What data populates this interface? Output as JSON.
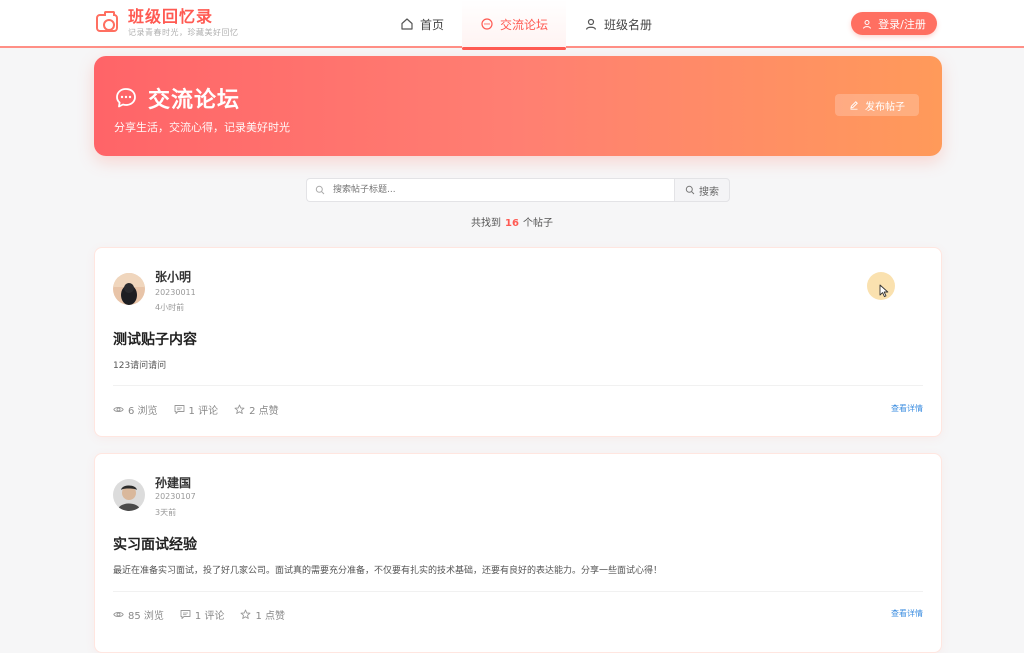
{
  "brand": {
    "title": "班级回忆录",
    "subtitle": "记录青春时光，珍藏美好回忆"
  },
  "nav": {
    "items": [
      {
        "label": "首页",
        "icon": "home-icon",
        "active": false
      },
      {
        "label": "交流论坛",
        "icon": "chat-icon",
        "active": true
      },
      {
        "label": "班级名册",
        "icon": "user-icon",
        "active": false
      }
    ],
    "login_label": "登录/注册"
  },
  "hero": {
    "title": "交流论坛",
    "subtitle": "分享生活，交流心得，记录美好时光",
    "post_button": "发布帖子"
  },
  "search": {
    "placeholder": "搜索帖子标题...",
    "button": "搜索"
  },
  "result": {
    "prefix": "共找到",
    "count": "16",
    "suffix": "个帖子"
  },
  "posts": [
    {
      "author": "张小明",
      "student_id": "20230011",
      "time": "4小时前",
      "title": "测试贴子内容",
      "body": "123请问请问",
      "views": "6 浏览",
      "comments": "1 评论",
      "likes": "2 点赞",
      "detail": "查看详情"
    },
    {
      "author": "孙建国",
      "student_id": "20230107",
      "time": "3天前",
      "title": "实习面试经验",
      "body": "最近在准备实习面试，投了好几家公司。面试真的需要充分准备，不仅要有扎实的技术基础，还要有良好的表达能力。分享一些面试心得！",
      "views": "85 浏览",
      "comments": "1 评论",
      "likes": "1 点赞",
      "detail": "查看详情"
    }
  ],
  "colors": {
    "accent": "#ff5a52",
    "link": "#3b8de0"
  }
}
